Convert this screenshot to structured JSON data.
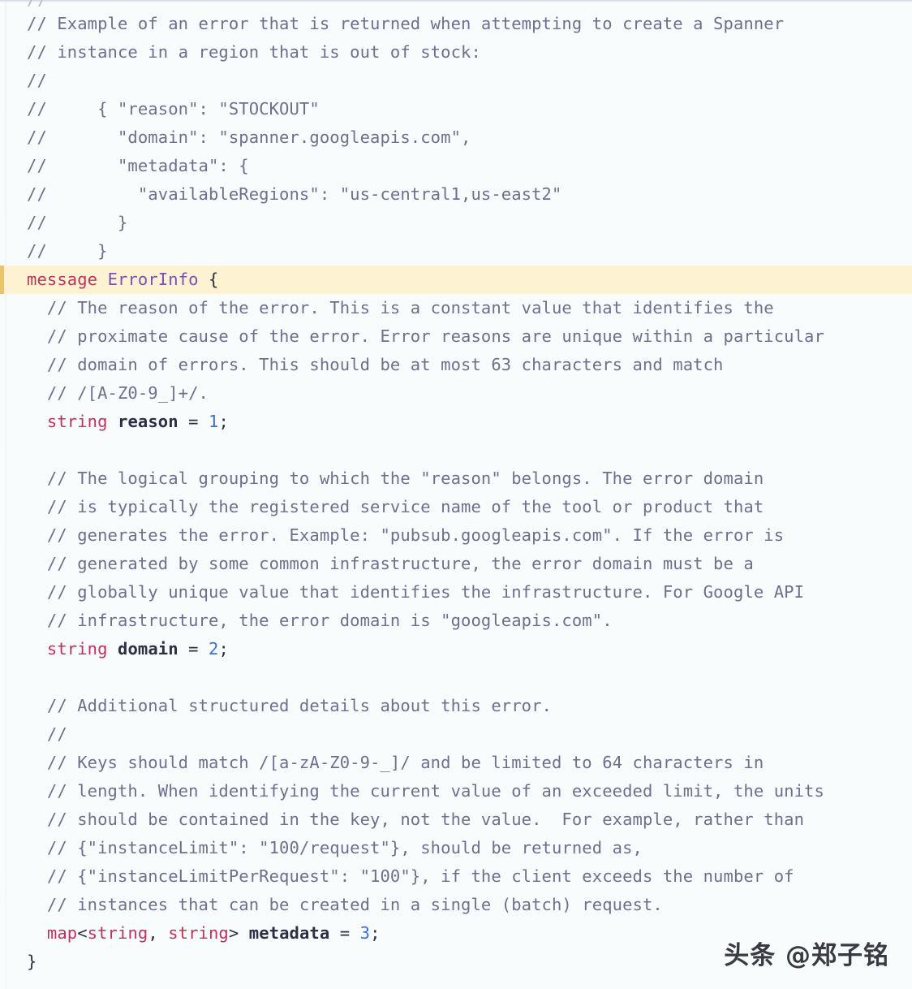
{
  "document": {
    "language": "protobuf",
    "background_color": "#f9fcfd",
    "highlight_color": "#fdf3d2",
    "highlight_bar_color": "#e8c46a",
    "top_partial_line": "//"
  },
  "watermark": {
    "text": "头条 @郑子铭"
  },
  "code": {
    "lines": [
      {
        "type": "comment",
        "text": "// Example of an error that is returned when attempting to create a Spanner"
      },
      {
        "type": "comment",
        "text": "// instance in a region that is out of stock:"
      },
      {
        "type": "comment",
        "text": "//"
      },
      {
        "type": "comment",
        "text": "//     { \"reason\": \"STOCKOUT\""
      },
      {
        "type": "comment",
        "text": "//       \"domain\": \"spanner.googleapis.com\","
      },
      {
        "type": "comment",
        "text": "//       \"metadata\": {"
      },
      {
        "type": "comment",
        "text": "//         \"availableRegions\": \"us-central1,us-east2\""
      },
      {
        "type": "comment",
        "text": "//       }"
      },
      {
        "type": "comment",
        "text": "//     }"
      },
      {
        "type": "declaration",
        "highlighted": true,
        "keyword": "message",
        "name": "ErrorInfo",
        "brace": " {"
      },
      {
        "type": "comment",
        "indent": 1,
        "text": "// The reason of the error. This is a constant value that identifies the"
      },
      {
        "type": "comment",
        "indent": 1,
        "text": "// proximate cause of the error. Error reasons are unique within a particular"
      },
      {
        "type": "comment",
        "indent": 1,
        "text": "// domain of errors. This should be at most 63 characters and match"
      },
      {
        "type": "comment",
        "indent": 1,
        "text": "// /[A-Z0-9_]+/."
      },
      {
        "type": "field",
        "indent": 1,
        "field_type": "string",
        "name": "reason",
        "number": "1"
      },
      {
        "type": "blank"
      },
      {
        "type": "comment",
        "indent": 1,
        "text": "// The logical grouping to which the \"reason\" belongs. The error domain"
      },
      {
        "type": "comment",
        "indent": 1,
        "text": "// is typically the registered service name of the tool or product that"
      },
      {
        "type": "comment",
        "indent": 1,
        "text": "// generates the error. Example: \"pubsub.googleapis.com\". If the error is"
      },
      {
        "type": "comment",
        "indent": 1,
        "text": "// generated by some common infrastructure, the error domain must be a"
      },
      {
        "type": "comment",
        "indent": 1,
        "text": "// globally unique value that identifies the infrastructure. For Google API"
      },
      {
        "type": "comment",
        "indent": 1,
        "text": "// infrastructure, the error domain is \"googleapis.com\"."
      },
      {
        "type": "field",
        "indent": 1,
        "field_type": "string",
        "name": "domain",
        "number": "2"
      },
      {
        "type": "blank"
      },
      {
        "type": "comment",
        "indent": 1,
        "text": "// Additional structured details about this error."
      },
      {
        "type": "comment",
        "indent": 1,
        "text": "//"
      },
      {
        "type": "comment",
        "indent": 1,
        "text": "// Keys should match /[a-zA-Z0-9-_]/ and be limited to 64 characters in"
      },
      {
        "type": "comment",
        "indent": 1,
        "text": "// length. When identifying the current value of an exceeded limit, the units"
      },
      {
        "type": "comment",
        "indent": 1,
        "text": "// should be contained in the key, not the value.  For example, rather than"
      },
      {
        "type": "comment",
        "indent": 1,
        "text": "// {\"instanceLimit\": \"100/request\"}, should be returned as,"
      },
      {
        "type": "comment",
        "indent": 1,
        "text": "// {\"instanceLimitPerRequest\": \"100\"}, if the client exceeds the number of"
      },
      {
        "type": "comment",
        "indent": 1,
        "text": "// instances that can be created in a single (batch) request."
      },
      {
        "type": "map_field",
        "indent": 1,
        "map_keyword": "map",
        "key_type": "string",
        "value_type": "string",
        "name": "metadata",
        "number": "3"
      },
      {
        "type": "close_brace",
        "text": "}"
      }
    ]
  }
}
